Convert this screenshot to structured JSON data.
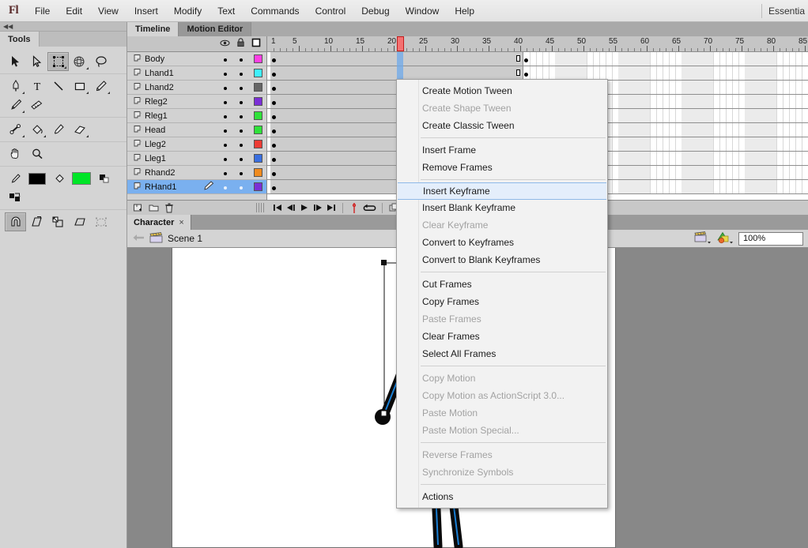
{
  "app": {
    "logo": "Fl",
    "workspace": "Essentia"
  },
  "menubar": {
    "items": [
      {
        "label": "File"
      },
      {
        "label": "Edit"
      },
      {
        "label": "View"
      },
      {
        "label": "Insert"
      },
      {
        "label": "Modify"
      },
      {
        "label": "Text"
      },
      {
        "label": "Commands"
      },
      {
        "label": "Control"
      },
      {
        "label": "Debug"
      },
      {
        "label": "Window"
      },
      {
        "label": "Help"
      }
    ]
  },
  "tools_panel": {
    "collapse_glyph": "◀◀",
    "tab_label": "Tools",
    "groups": [
      {
        "tools": [
          {
            "name": "selection-tool",
            "active": false
          },
          {
            "name": "subselection-tool",
            "active": false
          },
          {
            "name": "free-transform-tool",
            "active": true
          },
          {
            "name": "3d-rotation-tool",
            "active": false
          },
          {
            "name": "lasso-tool",
            "active": false
          }
        ]
      },
      {
        "tools": [
          {
            "name": "pen-tool",
            "active": false
          },
          {
            "name": "text-tool",
            "active": false
          },
          {
            "name": "line-tool",
            "active": false
          },
          {
            "name": "rectangle-tool",
            "active": false
          },
          {
            "name": "pencil-tool",
            "active": false
          },
          {
            "name": "brush-tool",
            "active": false
          },
          {
            "name": "deco-tool",
            "active": false
          }
        ]
      },
      {
        "tools": [
          {
            "name": "bone-tool",
            "active": false
          },
          {
            "name": "paint-bucket-tool",
            "active": false
          },
          {
            "name": "eyedropper-tool",
            "active": false
          },
          {
            "name": "eraser-tool",
            "active": false
          }
        ]
      },
      {
        "tools": [
          {
            "name": "hand-tool",
            "active": false
          },
          {
            "name": "zoom-tool",
            "active": false
          }
        ]
      },
      {
        "tools": [
          {
            "name": "stroke-color-swatch",
            "active": false
          },
          {
            "name": "fill-color-swatch",
            "active": false
          },
          {
            "name": "black-and-white-button",
            "active": false
          },
          {
            "name": "swap-colors-button",
            "active": false
          }
        ]
      },
      {
        "tools": [
          {
            "name": "snap-to-objects-toggle",
            "active": true
          },
          {
            "name": "rotate-and-skew-option",
            "active": false
          },
          {
            "name": "scale-option",
            "active": false
          },
          {
            "name": "distort-option",
            "active": false
          },
          {
            "name": "envelope-option",
            "active": false
          }
        ]
      }
    ],
    "stroke_color": "#000000",
    "fill_color": "#00e527"
  },
  "timeline": {
    "tabs": [
      {
        "label": "Timeline",
        "active": true
      },
      {
        "label": "Motion Editor",
        "active": false
      }
    ],
    "header_icons": [
      "eye-icon",
      "lock-icon",
      "outline-icon"
    ],
    "playhead_frame": 21,
    "span_end_frame": 40,
    "ruler_labels": [
      1,
      5,
      10,
      15,
      20,
      25,
      30,
      35,
      40,
      45,
      50,
      55,
      60,
      65,
      70,
      75,
      80,
      85
    ],
    "layers": [
      {
        "name": "Body",
        "color": "#ff3fe4",
        "selected": false
      },
      {
        "name": "Lhand1",
        "color": "#3ff0ff",
        "selected": false
      },
      {
        "name": "Lhand2",
        "color": "#666666",
        "selected": false
      },
      {
        "name": "Rleg2",
        "color": "#7b2fd6",
        "selected": false
      },
      {
        "name": "Rleg1",
        "color": "#2fe23a",
        "selected": false
      },
      {
        "name": "Head",
        "color": "#2fe23a",
        "selected": false
      },
      {
        "name": "Lleg2",
        "color": "#ee3b33",
        "selected": false
      },
      {
        "name": "Lleg1",
        "color": "#3a6fe0",
        "selected": false
      },
      {
        "name": "Rhand2",
        "color": "#f08b1e",
        "selected": false
      },
      {
        "name": "RHand1",
        "color": "#7b2fd6",
        "selected": true
      }
    ],
    "footer": {
      "left_buttons": [
        "new-layer-icon",
        "new-folder-icon",
        "delete-layer-icon"
      ],
      "playback_buttons": [
        "go-to-first-frame-icon",
        "step-back-one-frame-icon",
        "play-icon",
        "step-forward-one-frame-icon",
        "go-to-last-frame-icon"
      ],
      "extra_buttons": [
        "loop-playback-icon",
        "onion-skin-icon",
        "onion-skin-outlines-icon"
      ]
    }
  },
  "document": {
    "tab": {
      "label": "Character",
      "close_glyph": "×"
    },
    "breadcrumb": {
      "back_glyph": "←",
      "scene": "Scene 1"
    },
    "zoom": "100%",
    "scene_icons": [
      "edit-scene-icon",
      "edit-symbols-icon"
    ]
  },
  "context_menu": {
    "sections": [
      {
        "items": [
          {
            "label": "Create Motion Tween",
            "enabled": true,
            "highlight": false
          },
          {
            "label": "Create Shape Tween",
            "enabled": false,
            "highlight": false
          },
          {
            "label": "Create Classic Tween",
            "enabled": true,
            "highlight": false
          }
        ]
      },
      {
        "items": [
          {
            "label": "Insert Frame",
            "enabled": true,
            "highlight": false
          },
          {
            "label": "Remove Frames",
            "enabled": true,
            "highlight": false
          }
        ]
      },
      {
        "items": [
          {
            "label": "Insert Keyframe",
            "enabled": true,
            "highlight": true
          },
          {
            "label": "Insert Blank Keyframe",
            "enabled": true,
            "highlight": false
          },
          {
            "label": "Clear Keyframe",
            "enabled": false,
            "highlight": false
          },
          {
            "label": "Convert to Keyframes",
            "enabled": true,
            "highlight": false
          },
          {
            "label": "Convert to Blank Keyframes",
            "enabled": true,
            "highlight": false
          }
        ]
      },
      {
        "items": [
          {
            "label": "Cut Frames",
            "enabled": true,
            "highlight": false
          },
          {
            "label": "Copy Frames",
            "enabled": true,
            "highlight": false
          },
          {
            "label": "Paste Frames",
            "enabled": false,
            "highlight": false
          },
          {
            "label": "Clear Frames",
            "enabled": true,
            "highlight": false
          },
          {
            "label": "Select All Frames",
            "enabled": true,
            "highlight": false
          }
        ]
      },
      {
        "items": [
          {
            "label": "Copy Motion",
            "enabled": false,
            "highlight": false
          },
          {
            "label": "Copy Motion as ActionScript 3.0...",
            "enabled": false,
            "highlight": false
          },
          {
            "label": "Paste Motion",
            "enabled": false,
            "highlight": false
          },
          {
            "label": "Paste Motion Special...",
            "enabled": false,
            "highlight": false
          }
        ]
      },
      {
        "items": [
          {
            "label": "Reverse Frames",
            "enabled": false,
            "highlight": false
          },
          {
            "label": "Synchronize Symbols",
            "enabled": false,
            "highlight": false
          }
        ]
      },
      {
        "items": [
          {
            "label": "Actions",
            "enabled": true,
            "highlight": false
          }
        ]
      }
    ]
  },
  "stage": {
    "selection_color": "#3aa0f0",
    "head_color": "#22dd22",
    "limb_color": "#0a0a0a",
    "limb_highlight": "#1a7fd4"
  }
}
